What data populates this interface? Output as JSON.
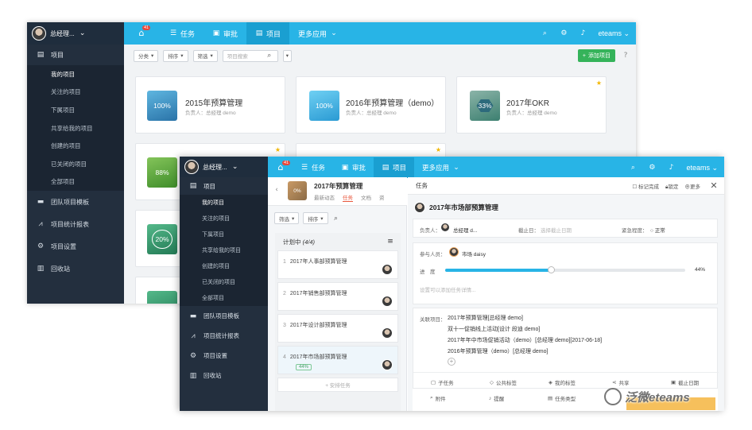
{
  "colors": {
    "topbar": "#28b4e6",
    "sidebar": "#232f3e",
    "accent_green": "#35b35a",
    "tab_red": "#e8583e"
  },
  "back": {
    "user_name": "总经理...",
    "nav": [
      {
        "label": "",
        "badge": "41",
        "icon": "home-icon"
      },
      {
        "label": "任务",
        "icon": "list-icon"
      },
      {
        "label": "审批",
        "icon": "approval-icon"
      },
      {
        "label": "项目",
        "icon": "project-icon"
      },
      {
        "label": "更多应用",
        "icon": "chevron-down-icon"
      }
    ],
    "right_label": "eteams",
    "sidebar": {
      "head": "项目",
      "items": [
        "我的项目",
        "关注的项目",
        "下属项目",
        "共享给我的项目",
        "创建的项目",
        "已关闭的项目",
        "全部项目"
      ],
      "sections": [
        "团队项目模板",
        "项目统计报表",
        "项目设置",
        "回收站"
      ]
    },
    "toolbar": {
      "f1": "分类",
      "f2": "排序",
      "f3": "筛选",
      "search_placeholder": "项目搜索",
      "add_label": "添加项目"
    },
    "cards": [
      {
        "pct": "100%",
        "title": "2015年预算管理",
        "owner": "负责人：总经理 demo",
        "color": "#2f8fbf"
      },
      {
        "pct": "100%",
        "title": "2016年预算管理（demo）",
        "owner": "负责人：总经理 demo",
        "color": "#30a9dc"
      },
      {
        "pct": "33%",
        "title": "2017年OKR",
        "owner": "负责人：总经理 demo",
        "color": "#4f9c8a"
      },
      {
        "pct": "88%",
        "color": "#5aa23c"
      },
      {
        "pct": "20%",
        "color": "#2f9a6a"
      }
    ]
  },
  "front": {
    "user_name": "总经理...",
    "badge": "41",
    "nav": [
      "任务",
      "审批",
      "项目",
      "更多应用"
    ],
    "right_label": "eteams",
    "sidebar": {
      "head": "项目",
      "items": [
        "我的项目",
        "关注的项目",
        "下属项目",
        "共享给我的项目",
        "创建的项目",
        "已关闭的项目",
        "全部项目"
      ],
      "sections": [
        "团队项目模板",
        "项目统计报表",
        "项目设置",
        "回收站"
      ]
    },
    "mid": {
      "pct": "0%",
      "title": "2017年预算管理",
      "tabs": [
        "最新动态",
        "任务",
        "文档",
        "资"
      ],
      "f1": "筛选",
      "f2": "排序",
      "column_title": "计划中",
      "column_count": "(4/4)",
      "tasks": [
        {
          "num": "1",
          "title": "2017年人事部预算管理"
        },
        {
          "num": "2",
          "title": "2017年销售部预算管理"
        },
        {
          "num": "3",
          "title": "2017年设计部预算管理"
        },
        {
          "num": "4",
          "title": "2017年市场部预算管理",
          "pct": "44%"
        }
      ],
      "add_task": "+ 安排任务"
    },
    "detail": {
      "header": "任务",
      "tools": [
        "标记完成",
        "锁定",
        "更多"
      ],
      "title": "2017年市场部预算管理",
      "owner_label": "负责人：",
      "owner": "总经理 d...",
      "deadline_label": "截止日：",
      "deadline_placeholder": "选择截止日期",
      "urgency_label": "紧急程度：",
      "urgency": "正常",
      "participants_label": "参与人员：",
      "participant": "市场 daisy",
      "progress_label": "进　度",
      "progress": 44,
      "progress_text": "44%",
      "desc_placeholder": "设置可以添加任务详情...",
      "related_label": "关联项目：",
      "related": [
        "2017年预算管理[总经理 demo]",
        "双十一促销线上活动[设计 段迪 demo]",
        "2017年年中市场促销活动（demo）[总经理 demo][2017-06-18]",
        "2016年预算管理（demo）[总经理 demo]"
      ],
      "actions_row1": [
        "子任务",
        "公共标签",
        "我的标签",
        "共享",
        "截止日期"
      ],
      "actions_row2": [
        "附件",
        "提醒",
        "任务类型"
      ]
    }
  },
  "watermark": "泛微eteams"
}
